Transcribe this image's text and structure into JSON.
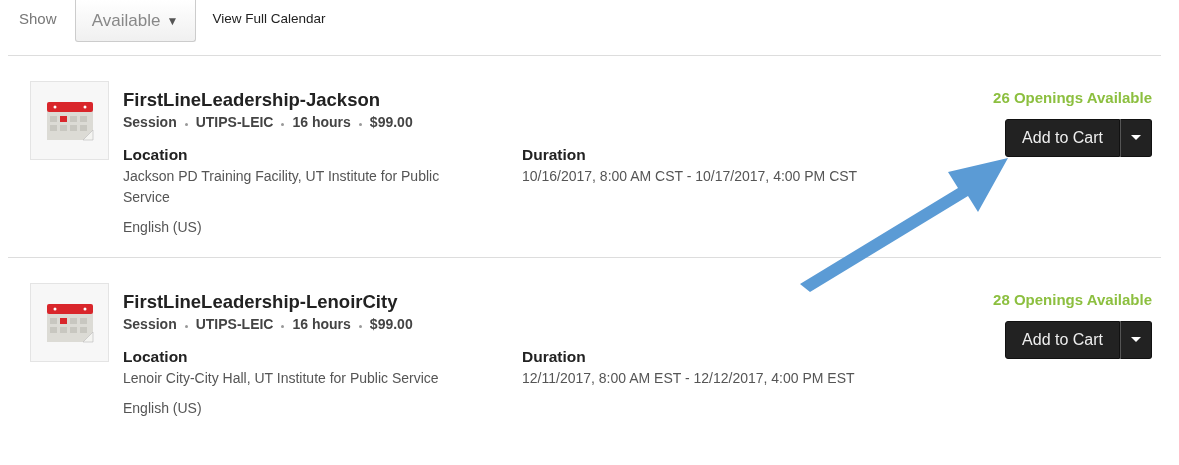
{
  "filter": {
    "label": "Show",
    "dropdown": {
      "value": "Available",
      "caret": "▼"
    },
    "link": "View Full Calendar"
  },
  "sessions": [
    {
      "title": "FirstLineLeadership-Jackson",
      "meta": [
        "Session",
        "UTIPS-LEIC",
        "16 hours",
        "$99.00"
      ],
      "location_label": "Location",
      "location": "Jackson PD Training Facility, UT Institute for Public Service",
      "language": "English (US)",
      "duration_label": "Duration",
      "duration": "10/16/2017, 8:00 AM CST - 10/17/2017, 4:00 PM CST",
      "openings": "26 Openings Available",
      "button": "Add to Cart"
    },
    {
      "title": "FirstLineLeadership-LenoirCity",
      "meta": [
        "Session",
        "UTIPS-LEIC",
        "16 hours",
        "$99.00"
      ],
      "location_label": "Location",
      "location": "Lenoir City-City Hall, UT Institute for Public Service",
      "language": "English (US)",
      "duration_label": "Duration",
      "duration": "12/11/2017, 8:00 AM EST - 12/12/2017, 4:00 PM EST",
      "openings": "28 Openings Available",
      "button": "Add to Cart"
    }
  ]
}
